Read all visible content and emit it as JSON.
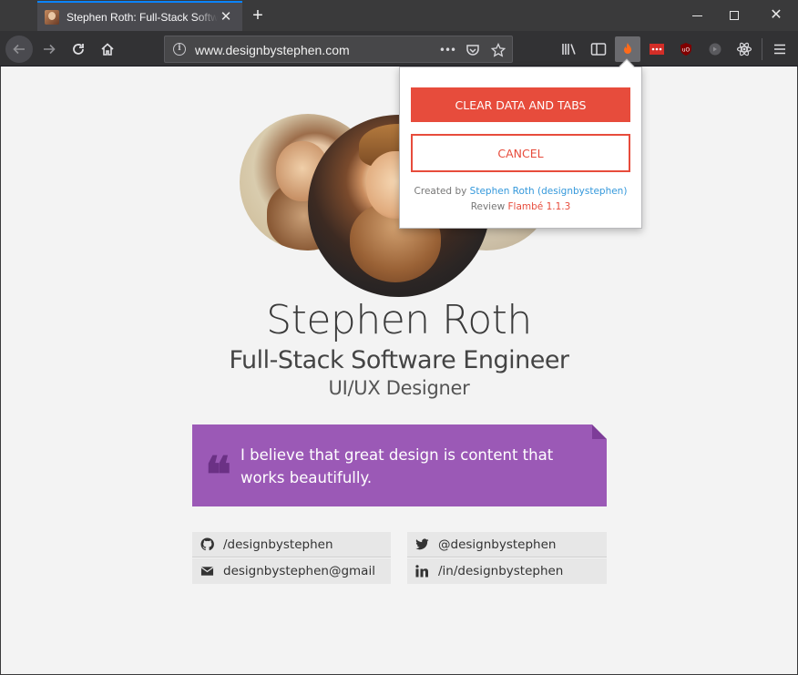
{
  "window": {
    "tab_title": "Stephen Roth: Full-Stack Software Engineer",
    "new_tab_label": "+",
    "close_label": "✕"
  },
  "toolbar": {
    "url_domain": "www.designbystephen.com",
    "url_prefix": "",
    "page_actions_label": "•••"
  },
  "profile": {
    "name": "Stephen Roth",
    "title": "Full-Stack Software Engineer",
    "subtitle": "UI/UX Designer",
    "quote": "I believe that great design is content that works beautifully."
  },
  "contacts": {
    "github": "/designbystephen",
    "twitter": "@designbystephen",
    "email": "designbystephen@gmail",
    "linkedin": "/in/designbystephen"
  },
  "popup": {
    "clear_label": "CLEAR DATA AND TABS",
    "cancel_label": "CANCEL",
    "created_by": "Created by",
    "author": "Stephen Roth (designbystephen)",
    "review": "Review",
    "extension": "Flambé 1.1.3"
  },
  "colors": {
    "accent_red": "#e74c3c",
    "quote_purple": "#9b59b6",
    "link_blue": "#3498db",
    "tab_highlight": "#0a84ff"
  },
  "icons": {
    "back": "back-arrow-icon",
    "forward": "forward-arrow-icon",
    "reload": "reload-icon",
    "home": "home-icon",
    "info": "info-icon",
    "pocket": "pocket-icon",
    "bookmark": "star-icon",
    "library": "library-icon",
    "sidebar": "sidebar-icon",
    "flambe": "flambe-flame-icon",
    "lastpass": "lastpass-icon",
    "ublock": "ublock-icon",
    "extension_gray": "extension-icon",
    "react": "react-devtools-icon",
    "menu": "hamburger-menu-icon"
  }
}
